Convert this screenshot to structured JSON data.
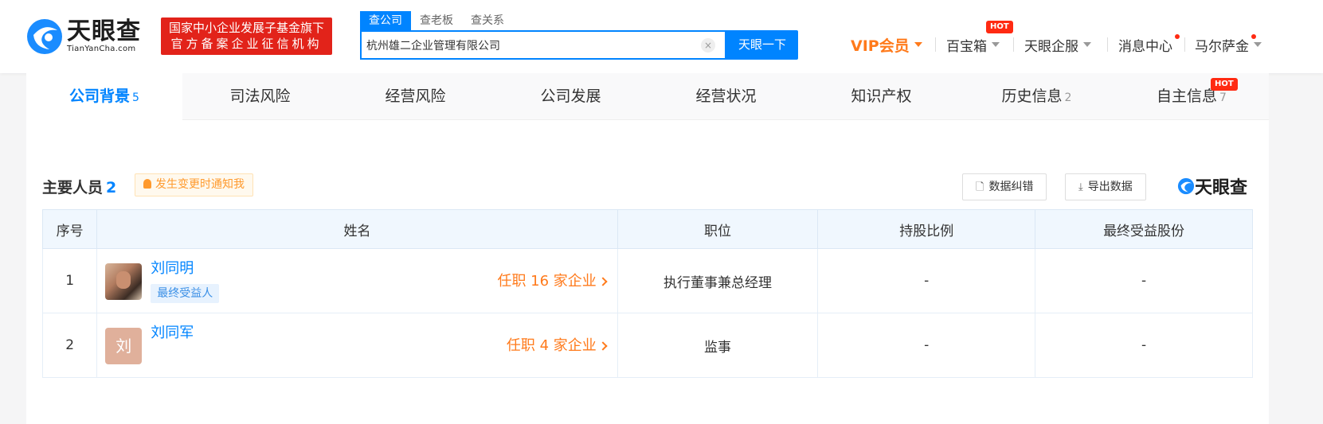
{
  "header": {
    "logo_cn": "天眼查",
    "logo_en": "TianYanCha.com",
    "badge_line1": "国家中小企业发展子基金旗下",
    "badge_line2": "官方备案企业征信机构"
  },
  "search": {
    "tabs": [
      "查公司",
      "查老板",
      "查关系"
    ],
    "value": "杭州雄二企业管理有限公司",
    "clear": "×",
    "button": "天眼一下"
  },
  "nav": {
    "vip": "VIP会员",
    "baibaoxiang": "百宝箱",
    "hot": "HOT",
    "qiban": "天眼企服",
    "messages": "消息中心",
    "user": "马尔萨金"
  },
  "content_tabs": [
    {
      "label": "公司背景",
      "count": "5"
    },
    {
      "label": "司法风险",
      "count": ""
    },
    {
      "label": "经营风险",
      "count": ""
    },
    {
      "label": "公司发展",
      "count": ""
    },
    {
      "label": "经营状况",
      "count": ""
    },
    {
      "label": "知识产权",
      "count": ""
    },
    {
      "label": "历史信息",
      "count": "2"
    },
    {
      "label": "自主信息",
      "count": "7"
    }
  ],
  "tab_hot": "HOT",
  "section": {
    "title": "主要人员",
    "count": "2",
    "notify": "发生变更时通知我",
    "correct_btn": "数据纠错",
    "export_btn": "导出数据",
    "brand": "天眼查"
  },
  "table": {
    "headers": [
      "序号",
      "姓名",
      "职位",
      "持股比例",
      "最终受益股份"
    ],
    "rows": [
      {
        "index": "1",
        "name": "刘同明",
        "tag": "最终受益人",
        "jobs": "任职 16 家企业",
        "position": "执行董事兼总经理",
        "share": "-",
        "benefit": "-",
        "avatar": "photo"
      },
      {
        "index": "2",
        "name": "刘同军",
        "tag": "",
        "jobs": "任职 4 家企业",
        "position": "监事",
        "share": "-",
        "benefit": "-",
        "avatar_text": "刘"
      }
    ]
  }
}
